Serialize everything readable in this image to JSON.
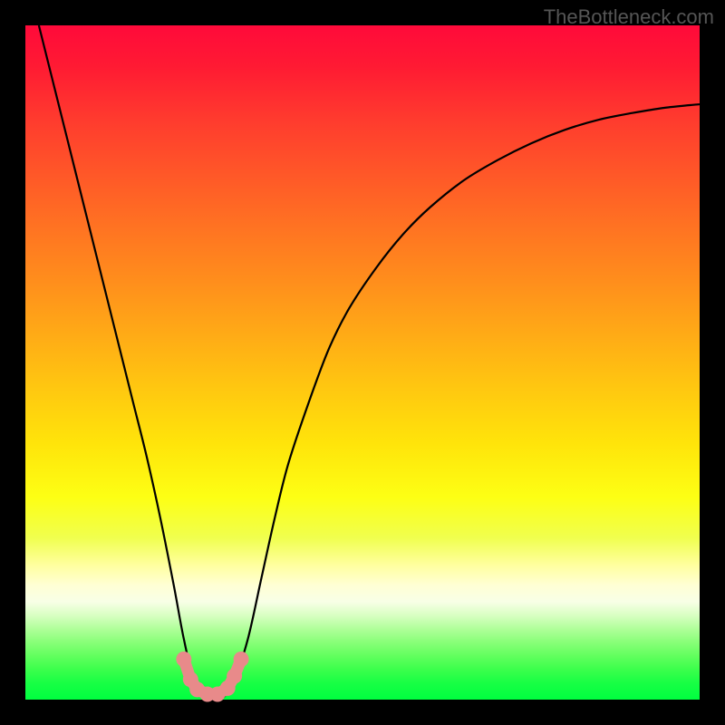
{
  "watermark": "TheBottleneck.com",
  "chart_data": {
    "type": "line",
    "title": "",
    "xlabel": "",
    "ylabel": "",
    "xlim": [
      0,
      100
    ],
    "ylim": [
      0,
      100
    ],
    "grid": false,
    "series": [
      {
        "name": "bottleneck-curve",
        "x": [
          2,
          4,
          6,
          8,
          10,
          12,
          14,
          16,
          18,
          20,
          22,
          23.5,
          25,
          27,
          29,
          31,
          33,
          35,
          37,
          39,
          42,
          45,
          48,
          52,
          56,
          60,
          65,
          70,
          75,
          80,
          85,
          90,
          95,
          100
        ],
        "y": [
          100,
          92,
          84,
          76,
          68,
          60,
          52,
          44,
          36,
          27,
          17,
          9,
          3,
          0,
          0,
          3,
          9,
          18,
          27,
          35,
          44,
          52,
          58,
          64,
          69,
          73,
          77,
          80,
          82.5,
          84.5,
          86,
          87,
          87.8,
          88.3
        ]
      }
    ],
    "markers": {
      "color": "#e88a8a",
      "points": [
        {
          "x": 23.5,
          "y": 6
        },
        {
          "x": 24.5,
          "y": 3
        },
        {
          "x": 25.5,
          "y": 1.5
        },
        {
          "x": 27,
          "y": 0.8
        },
        {
          "x": 28.5,
          "y": 0.8
        },
        {
          "x": 30,
          "y": 1.7
        },
        {
          "x": 31,
          "y": 3.5
        },
        {
          "x": 32,
          "y": 6
        }
      ]
    },
    "gradient_stops": [
      {
        "pos": 0,
        "color": "#ff0a3a"
      },
      {
        "pos": 70,
        "color": "#fdff14"
      },
      {
        "pos": 85,
        "color": "#f8ffe6"
      },
      {
        "pos": 100,
        "color": "#00ff40"
      }
    ]
  }
}
